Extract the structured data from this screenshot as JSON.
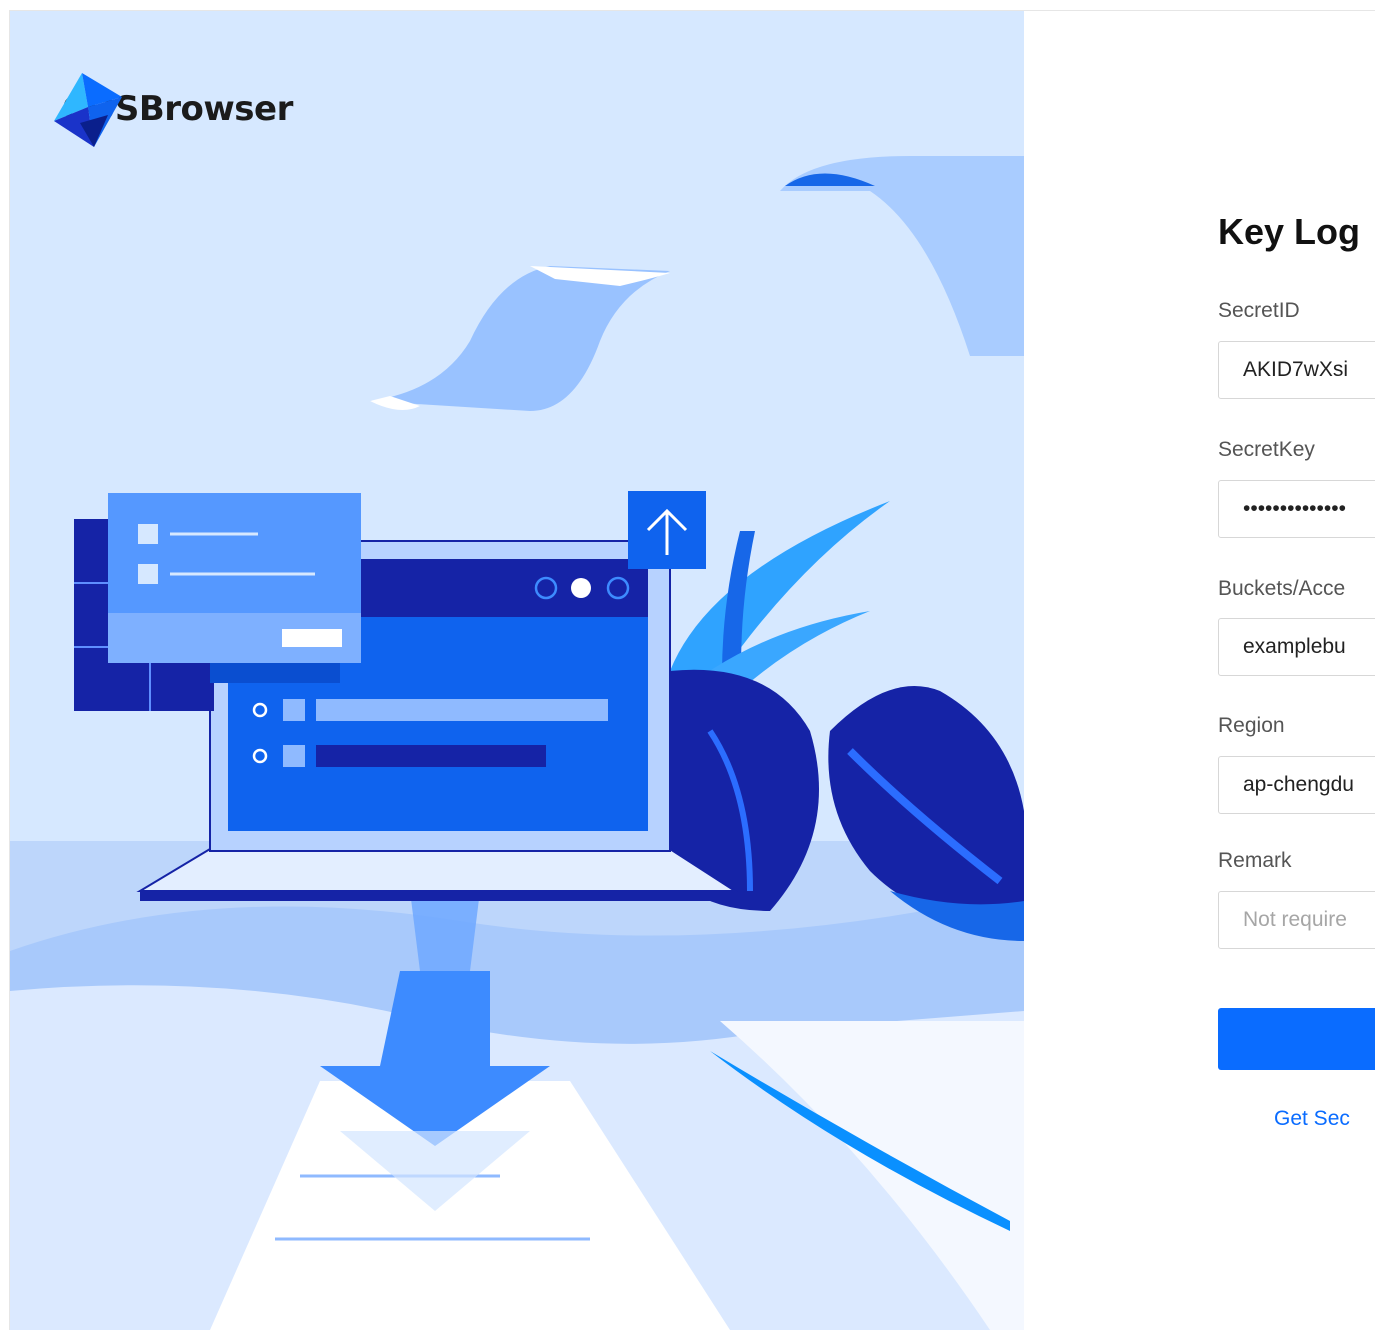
{
  "app": {
    "brand_name": "COSBrowser",
    "accent_color": "#0a6cff"
  },
  "illustration": {
    "icons": [
      "upload-arrow-icon",
      "download-arrow-icon",
      "laptop",
      "leaf"
    ]
  },
  "login": {
    "title": "Key Log",
    "fields": [
      {
        "label": "SecretID",
        "value": "AKID7wXsi",
        "placeholder": ""
      },
      {
        "label": "SecretKey",
        "value": "••••••••••••••",
        "placeholder": ""
      },
      {
        "label": "Buckets/Acce",
        "value": "examplebu",
        "placeholder": ""
      },
      {
        "label": "Region",
        "value": "ap-chengdu",
        "placeholder": ""
      },
      {
        "label": "Remark",
        "value": "",
        "placeholder": "Not require"
      }
    ],
    "submit_label": "",
    "get_key_link": "Get Sec"
  }
}
